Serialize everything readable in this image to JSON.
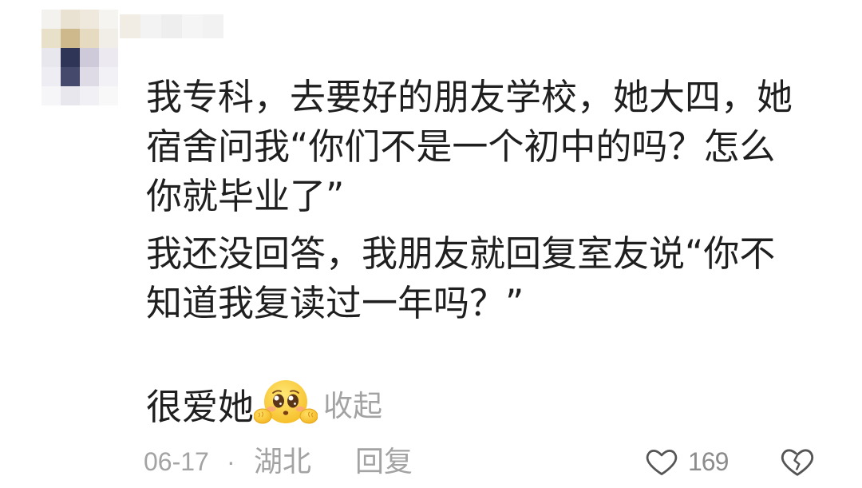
{
  "comment": {
    "avatar": {
      "mosaic": [
        [
          "#f4f2ee",
          "#e9e2d2",
          "#efe9dd",
          "#f5f4f1"
        ],
        [
          "#e9e0c9",
          "#cdb98c",
          "#e6dac0",
          "#f1eee8"
        ],
        [
          "#e9e7ee",
          "#2f3557",
          "#cfcad9",
          "#eceaf0"
        ],
        [
          "#eeedf3",
          "#454a6c",
          "#dedbe6",
          "#f2f1f5"
        ],
        [
          "#f6f6f8",
          "#e8e7ee",
          "#f1f0f4",
          "#f8f8f9"
        ]
      ]
    },
    "username": {
      "mosaic": [
        "#f1ede4",
        "#f3f3f3",
        "#eeeeee",
        "#f5f5f5",
        "#f2f2f2"
      ]
    },
    "body": {
      "paragraphs": [
        {
          "lines": [
            "我专科，去要好的朋友学校，她大四，她",
            "宿舍问我“你们不是一个初中的吗？怎么",
            "你就毕业了”"
          ]
        },
        {
          "lines": [
            "我还没回答，我朋友就回复室友说“你不",
            "知道我复读过一年吗？”"
          ]
        }
      ],
      "closing": {
        "text": "很爱她",
        "emoji": "pleading-face-with-hands-emoji",
        "collapse_label": "收起"
      }
    },
    "meta": {
      "date": "06-17",
      "separator": "·",
      "location": "湖北",
      "reply_label": "回复"
    },
    "actions": {
      "like_icon": "heart-icon",
      "like_count": "169",
      "dislike_icon": "broken-heart-icon"
    }
  },
  "colors": {
    "text": "#1f1f1f",
    "secondary": "#a3a3a3",
    "icon": "#555555"
  }
}
